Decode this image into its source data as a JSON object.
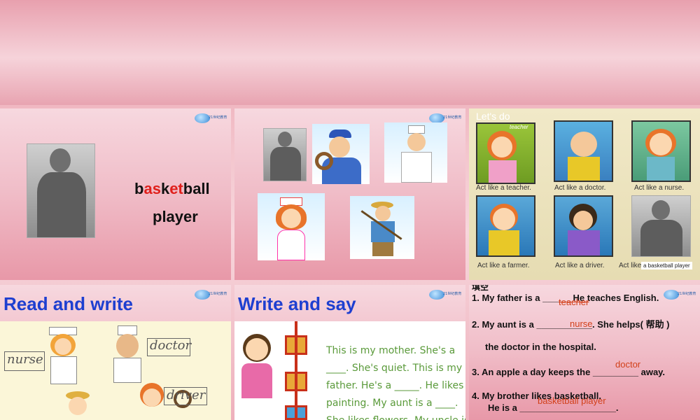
{
  "slide1": {
    "word_prefix_1": "b",
    "word_red_1": "as",
    "word_mid": "k",
    "word_red_2": "et",
    "word_suffix": "ball",
    "word2": "player"
  },
  "slide3": {
    "title": "Let's do",
    "teacher_tag": "teacher",
    "captions": [
      "Act like a teacher.",
      "Act like a doctor.",
      "Act like a nurse.",
      "Act like a farmer.",
      "Act like a driver.",
      "Act like"
    ],
    "basketball_tag": "a basketball player"
  },
  "slide4": {
    "title": "Read and write",
    "labels": [
      "nurse",
      "doctor",
      "driver"
    ]
  },
  "slide5": {
    "title": "Write and say",
    "lines": [
      "This is my mother. She's a",
      "____. She's quiet. This is my",
      "father. He's a _____. He likes",
      "painting.  My aunt is a ____.",
      "She likes flowers. My uncle is"
    ]
  },
  "slide6": {
    "header": "填空",
    "items": [
      {
        "text": "1.  My father is a ______He teaches English.",
        "answer": "teacher"
      },
      {
        "text": "2.  My aunt is a ___________. She helps( 帮助 )",
        "answer": "nurse"
      },
      {
        "text": "the doctor in the hospital.",
        "answer": ""
      },
      {
        "text": "3.  An apple a day keeps the _________ away.",
        "answer": "doctor"
      },
      {
        "text": "4.  My brother likes basketball.",
        "answer": ""
      },
      {
        "text": "He is a ___________________.",
        "answer": "basketball player"
      }
    ]
  }
}
